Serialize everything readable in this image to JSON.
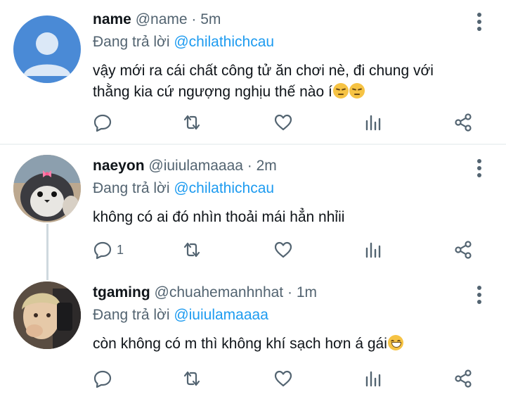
{
  "tweets": [
    {
      "name": "name",
      "handle": "@name",
      "time": "5m",
      "reply_prefix": "Đang trả lời",
      "reply_to": "@chilathichcau",
      "text_line1": "vậy mới ra cái chất công tử ăn chơi nè, đi chung với",
      "text_line2": "thằng kia cứ ngượng nghịu thế nào í",
      "reply_count": ""
    },
    {
      "name": "naeyon",
      "handle": "@iuiulamaaaa",
      "time": "2m",
      "reply_prefix": "Đang trả lời",
      "reply_to": "@chilathichcau",
      "text_line1": "không có ai đó nhìn thoải mái hẳn nhỉii",
      "reply_count": "1"
    },
    {
      "name": "tgaming",
      "handle": "@chuahemanhnhat",
      "time": "1m",
      "reply_prefix": "Đang trả lời",
      "reply_to": "@iuiulamaaaa",
      "text_line1": "còn không có m thì không khí sạch hơn á gái",
      "reply_count": ""
    }
  ],
  "separator": "·",
  "icons": [
    "reply-icon",
    "retweet-icon",
    "like-icon",
    "views-icon",
    "share-icon",
    "more-icon"
  ],
  "colors": {
    "link": "#1d9bf0",
    "muted": "#536471",
    "text": "#0f1419"
  }
}
